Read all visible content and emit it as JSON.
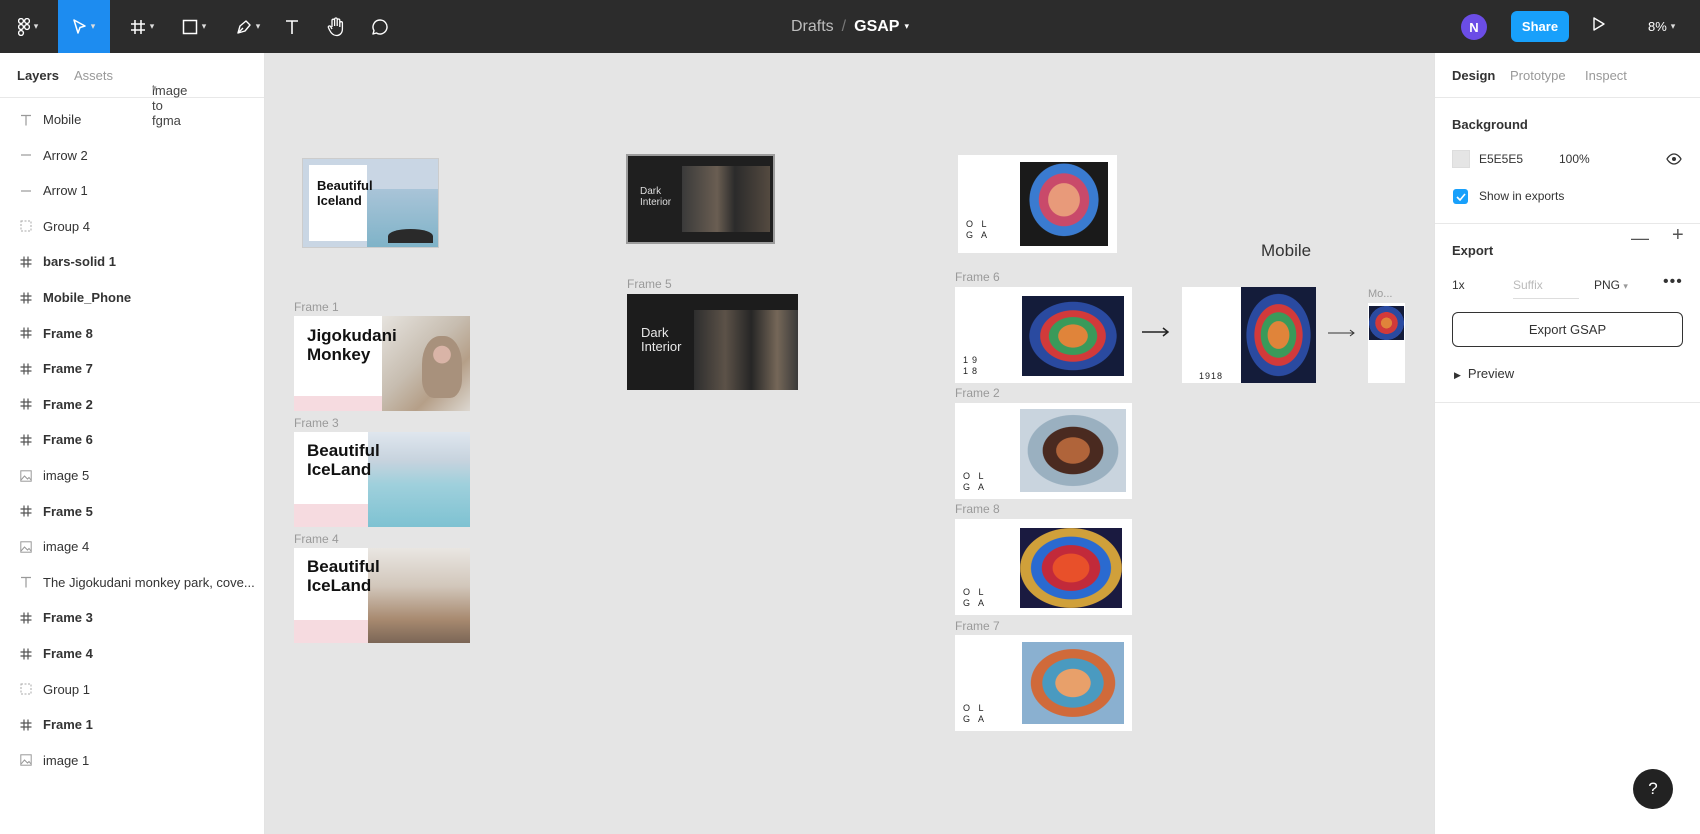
{
  "toolbar": {
    "breadcrumb_parent": "Drafts",
    "breadcrumb_sep": "/",
    "file_name": "GSAP",
    "avatar_initial": "N",
    "share_label": "Share",
    "zoom_level": "8%",
    "accent_color": "#18a0fb"
  },
  "left_panel": {
    "tabs": {
      "layers": "Layers",
      "assets": "Assets",
      "page": "image to fgma"
    },
    "layers": [
      {
        "label": "Mobile",
        "icon": "text-icon"
      },
      {
        "label": "Arrow 2",
        "icon": "line-icon"
      },
      {
        "label": "Arrow 1",
        "icon": "line-icon"
      },
      {
        "label": "Group 4",
        "icon": "group-icon"
      },
      {
        "label": "bars-solid 1",
        "icon": "frame-icon"
      },
      {
        "label": "Mobile_Phone",
        "icon": "frame-icon"
      },
      {
        "label": "Frame 8",
        "icon": "frame-icon"
      },
      {
        "label": "Frame 7",
        "icon": "frame-icon"
      },
      {
        "label": "Frame 2",
        "icon": "frame-icon"
      },
      {
        "label": "Frame 6",
        "icon": "frame-icon"
      },
      {
        "label": "image 5",
        "icon": "image-icon"
      },
      {
        "label": "Frame 5",
        "icon": "frame-icon"
      },
      {
        "label": "image 4",
        "icon": "image-icon"
      },
      {
        "label": "The Jigokudani monkey park, cove...",
        "icon": "text-icon"
      },
      {
        "label": "Frame 3",
        "icon": "frame-icon"
      },
      {
        "label": "Frame 4",
        "icon": "frame-icon"
      },
      {
        "label": "Group 1",
        "icon": "group-icon"
      },
      {
        "label": "Frame 1",
        "icon": "frame-icon"
      },
      {
        "label": "image 1",
        "icon": "image-icon"
      }
    ]
  },
  "right_panel": {
    "tabs": {
      "design": "Design",
      "prototype": "Prototype",
      "inspect": "Inspect"
    },
    "background": {
      "title": "Background",
      "hex": "E5E5E5",
      "opacity": "100%",
      "show_in_exports": "Show in exports"
    },
    "export": {
      "title": "Export",
      "minus": "—",
      "plus": "+",
      "scale": "1x",
      "suffix_placeholder": "Suffix",
      "format": "PNG",
      "more": "•••",
      "button": "Export GSAP",
      "preview": "Preview"
    },
    "help": "?"
  },
  "canvas": {
    "frames": {
      "frame1_label": "Frame 1",
      "frame1_title": "Jigokudani Monkey",
      "frame3_label": "Frame 3",
      "frame3_title": "Beautiful IceLand",
      "frame4_label": "Frame 4",
      "frame4_title": "Beautiful IceLand",
      "top_iceland_title": "Beautiful Iceland",
      "dark_title": "Dark Interior",
      "frame5_label": "Frame 5",
      "frame5_title": "Dark Interior",
      "frame6_label": "Frame 6",
      "frame6_year": "19 18",
      "frame2_label": "Frame 2",
      "frame8_label": "Frame 8",
      "frame7_label": "Frame 7",
      "olga": "O L G A",
      "mobile_heading": "Mobile",
      "mobile_year": "1918",
      "mobile_small_label": "Mo..."
    }
  }
}
